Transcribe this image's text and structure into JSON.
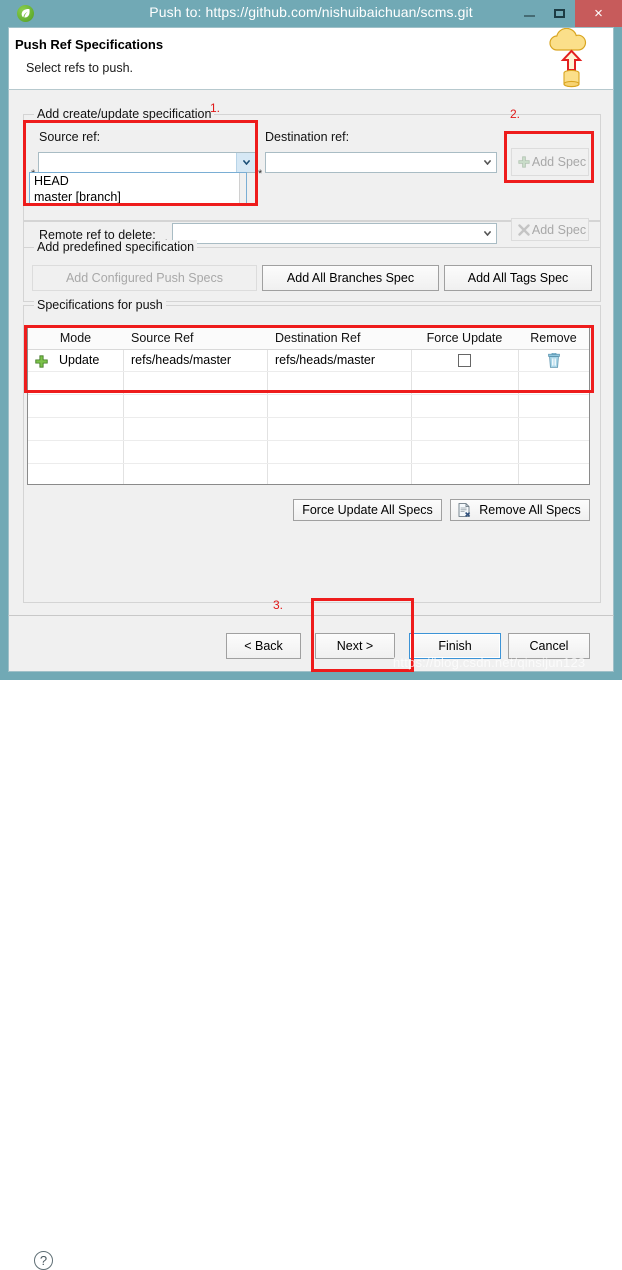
{
  "window": {
    "title": "Push to: https://github.com/nishuibaichuan/scms.git",
    "app_icon": "spring-leaf-icon",
    "minimize_label": "–",
    "maximize_label": "□",
    "close_label": "×",
    "titlebar_color": "#71a9b5",
    "close_button_color": "#c75b5b"
  },
  "header": {
    "title": "Push Ref Specifications",
    "subtitle": "Select refs to push.",
    "graphic": "cloud-push-icon"
  },
  "create_update_group": {
    "legend": "Add create/update specification",
    "source_ref": {
      "label": "Source ref:",
      "value": "",
      "required_marker": "*",
      "expanded": true,
      "options": [
        "HEAD",
        "master [branch]"
      ]
    },
    "destination_ref": {
      "label": "Destination ref:",
      "value": "",
      "required_marker": "*"
    },
    "add_spec_button": {
      "label": "Add Spec",
      "icon": "green-plus-icon",
      "enabled": false
    }
  },
  "delete_group": {
    "remote_ref_to_delete": {
      "label": "Remote ref to delete:",
      "value": "",
      "required_marker": "*"
    },
    "add_spec_button": {
      "label": "Add Spec",
      "icon": "grey-x-icon",
      "enabled": false
    }
  },
  "predefined_group": {
    "legend": "Add predefined specification",
    "buttons": [
      {
        "label": "Add Configured Push Specs",
        "enabled": false
      },
      {
        "label": "Add All Branches Spec",
        "enabled": true
      },
      {
        "label": "Add All Tags Spec",
        "enabled": true
      }
    ]
  },
  "spec_table": {
    "legend": "Specifications for push",
    "columns": [
      "Mode",
      "Source Ref",
      "Destination Ref",
      "Force Update",
      "Remove"
    ],
    "rows": [
      {
        "mode_icon": "green-plus-icon",
        "mode": "Update",
        "source_ref": "refs/heads/master",
        "destination_ref": "refs/heads/master",
        "force_update": false,
        "remove_icon": "trash-icon"
      }
    ],
    "empty_row_count": 5
  },
  "table_actions": [
    {
      "label": "Force Update All Specs",
      "icon": "",
      "enabled": true
    },
    {
      "label": "Remove All Specs",
      "icon": "document-remove-icon",
      "enabled": true
    }
  ],
  "footer": {
    "help_icon": "?",
    "buttons": [
      {
        "label": "< Back",
        "enabled": true,
        "focused": false
      },
      {
        "label": "Next >",
        "enabled": true,
        "focused": false
      },
      {
        "label": "Finish",
        "enabled": true,
        "focused": true
      },
      {
        "label": "Cancel",
        "enabled": true,
        "focused": false
      }
    ]
  },
  "annotations": {
    "color": "#ee1c1c",
    "numbers": [
      "1.",
      "2.",
      "3."
    ]
  },
  "watermark": "https://blog.csdn.net/qinsijun123"
}
